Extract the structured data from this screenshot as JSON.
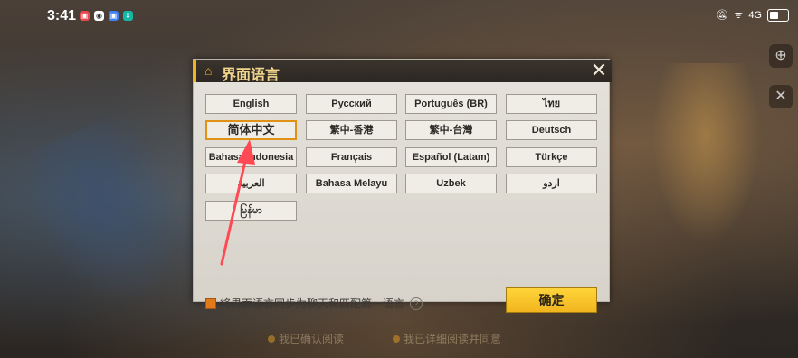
{
  "status_bar": {
    "time": "3:41",
    "app_icons": [
      {
        "name": "app-red",
        "color": "#e5484d",
        "glyph": "▣"
      },
      {
        "name": "app-white",
        "color": "#ffffff",
        "glyph": "◉"
      },
      {
        "name": "app-blue",
        "color": "#3b82f6",
        "glyph": "▣"
      },
      {
        "name": "app-teal",
        "color": "#14b8a6",
        "glyph": "⬇"
      }
    ],
    "signal_text": "4G"
  },
  "dialog": {
    "title": "界面语言",
    "languages": [
      {
        "label": "English",
        "selected": false
      },
      {
        "label": "Русский",
        "selected": false
      },
      {
        "label": "Português (BR)",
        "selected": false
      },
      {
        "label": "ไทย",
        "selected": false
      },
      {
        "label": "简体中文",
        "selected": true
      },
      {
        "label": "繁中-香港",
        "selected": false
      },
      {
        "label": "繁中-台灣",
        "selected": false
      },
      {
        "label": "Deutsch",
        "selected": false
      },
      {
        "label": "Bahasa Indonesia",
        "selected": false
      },
      {
        "label": "Français",
        "selected": false
      },
      {
        "label": "Español (Latam)",
        "selected": false
      },
      {
        "label": "Türkçe",
        "selected": false
      },
      {
        "label": "العربية",
        "selected": false
      },
      {
        "label": "Bahasa Melayu",
        "selected": false
      },
      {
        "label": "Uzbek",
        "selected": false
      },
      {
        "label": "اردو",
        "selected": false
      },
      {
        "label": "မြန်မာ",
        "selected": false
      }
    ],
    "sync_label": "将界面语言同步为聊天和匹配第一语言",
    "sync_checked": true,
    "confirm_label": "确定"
  },
  "background": {
    "bottom_left_text": "我已确认阅读",
    "bottom_right_text": "我已详细阅读并同意"
  },
  "colors": {
    "accent": "#f2b51f",
    "selected_border": "#e09214",
    "annotation_arrow": "#ff4a55"
  }
}
